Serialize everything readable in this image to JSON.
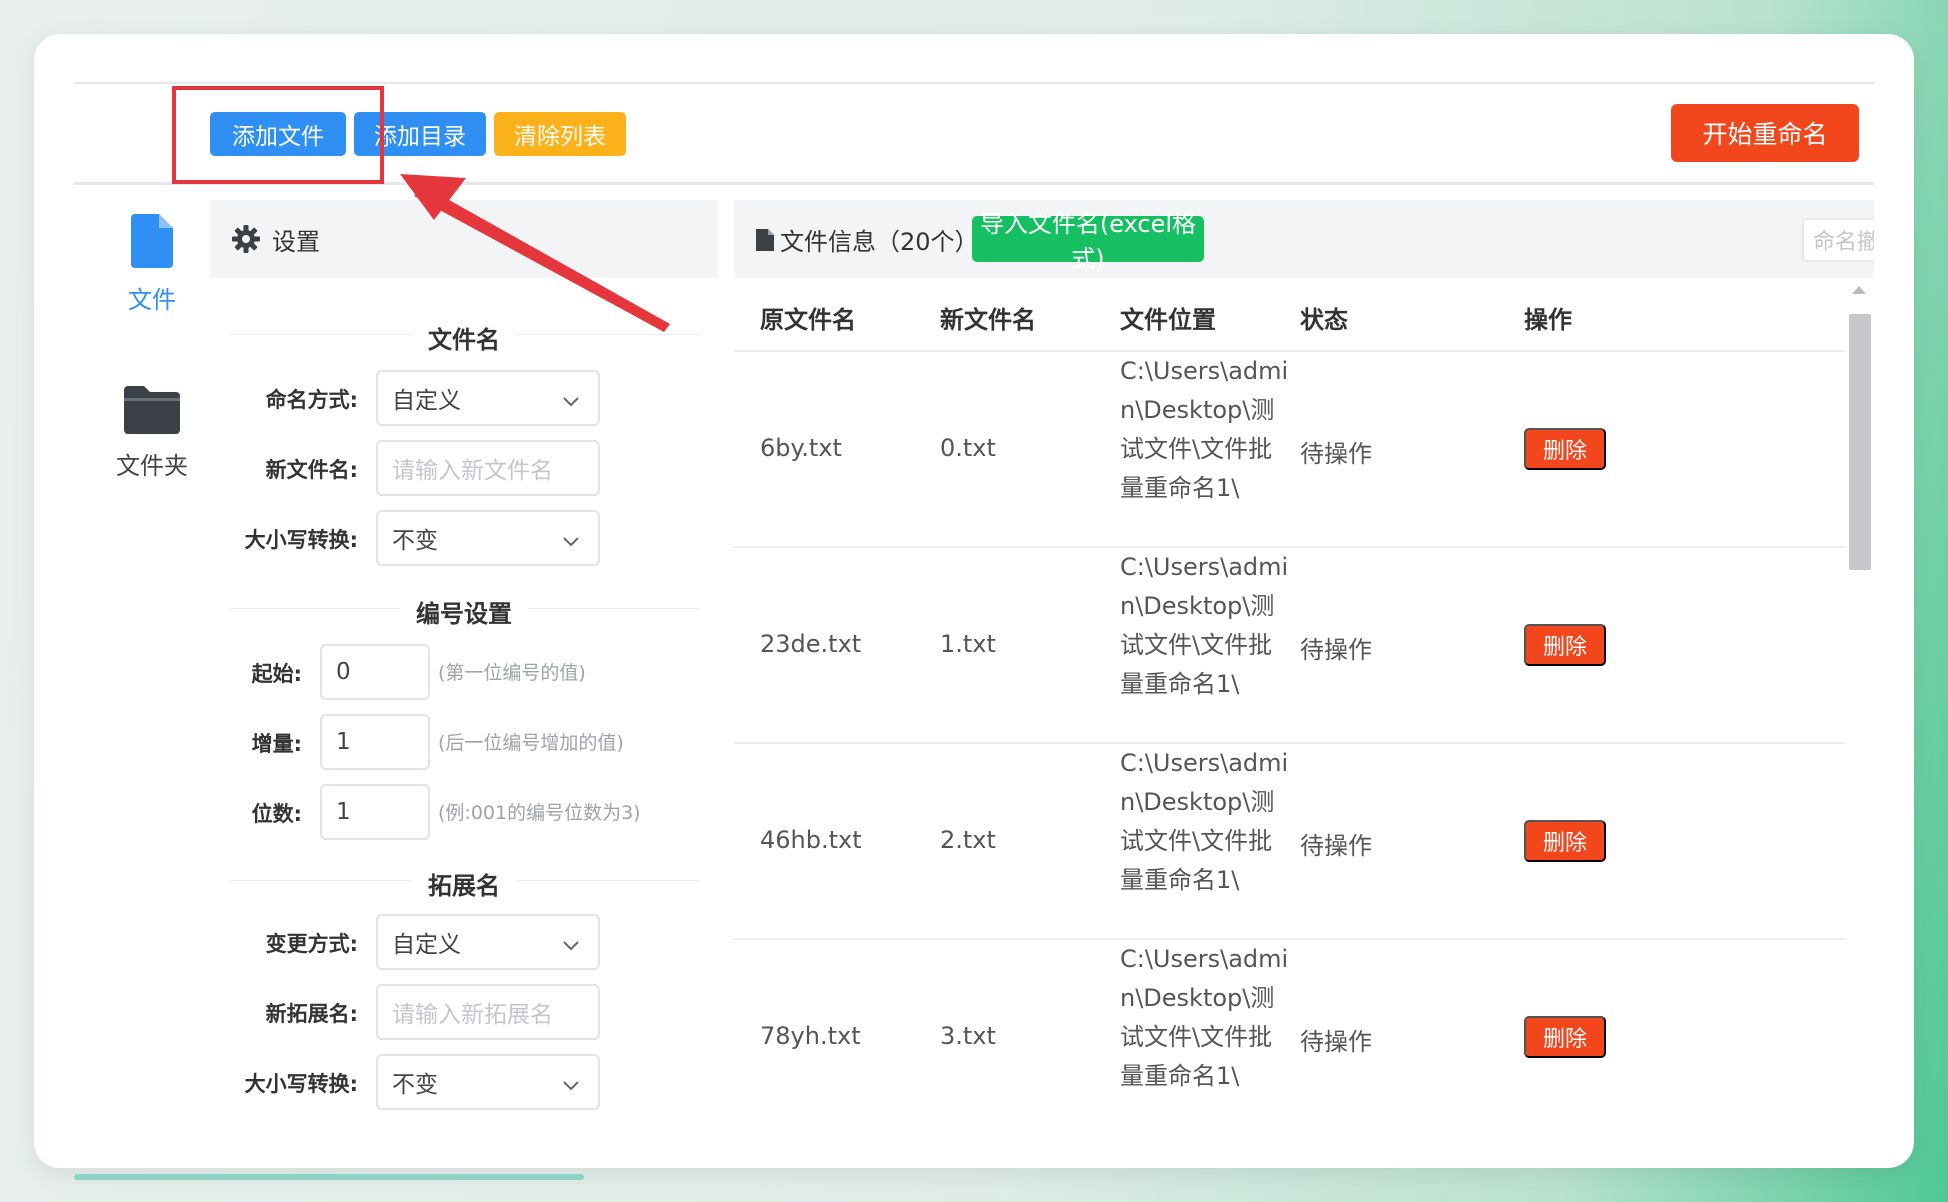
{
  "toolbar": {
    "add_file": "添加文件",
    "add_dir": "添加目录",
    "clear_list": "清除列表",
    "start_rename": "开始重命名"
  },
  "nav": {
    "file": "文件",
    "folder": "文件夹"
  },
  "settings": {
    "title": "设置",
    "filename_section": "文件名",
    "naming_mode_label": "命名方式:",
    "naming_mode_value": "自定义",
    "new_name_label": "新文件名:",
    "new_name_placeholder": "请输入新文件名",
    "case_label": "大小写转换:",
    "case_value": "不变",
    "numbering_section": "编号设置",
    "start_label": "起始:",
    "start_value": "0",
    "start_hint": "(第一位编号的值)",
    "increment_label": "增量:",
    "increment_value": "1",
    "increment_hint": "(后一位编号增加的值)",
    "digits_label": "位数:",
    "digits_value": "1",
    "digits_hint": "(例:001的编号位数为3)",
    "ext_section": "拓展名",
    "ext_mode_label": "变更方式:",
    "ext_mode_value": "自定义",
    "new_ext_label": "新拓展名:",
    "new_ext_placeholder": "请输入新拓展名",
    "ext_case_label": "大小写转换:",
    "ext_case_value": "不变"
  },
  "files": {
    "title": "文件信息（20个）",
    "import_btn": "导入文件名(excel格式)",
    "undo_btn": "命名撤回",
    "columns": [
      "原文件名",
      "新文件名",
      "文件位置",
      "状态",
      "操作"
    ],
    "rows": [
      {
        "orig": "6by.txt",
        "new": "0.txt",
        "path": "C:\\Users\\admin\\Desktop\\测试文件\\文件批量重命名1\\",
        "status": "待操作",
        "action": "删除"
      },
      {
        "orig": "23de.txt",
        "new": "1.txt",
        "path": "C:\\Users\\admin\\Desktop\\测试文件\\文件批量重命名1\\",
        "status": "待操作",
        "action": "删除"
      },
      {
        "orig": "46hb.txt",
        "new": "2.txt",
        "path": "C:\\Users\\admin\\Desktop\\测试文件\\文件批量重命名1\\",
        "status": "待操作",
        "action": "删除"
      },
      {
        "orig": "78yh.txt",
        "new": "3.txt",
        "path": "C:\\Users\\admin\\Desktop\\测试文件\\文件批量重命名1\\",
        "status": "待操作",
        "action": "删除"
      }
    ]
  },
  "colors": {
    "primary_blue": "#2f8ff3",
    "warning_orange": "#fbb21a",
    "danger_red": "#f2471c",
    "success_green": "#17bf63",
    "annotation_red": "#e4363b"
  }
}
